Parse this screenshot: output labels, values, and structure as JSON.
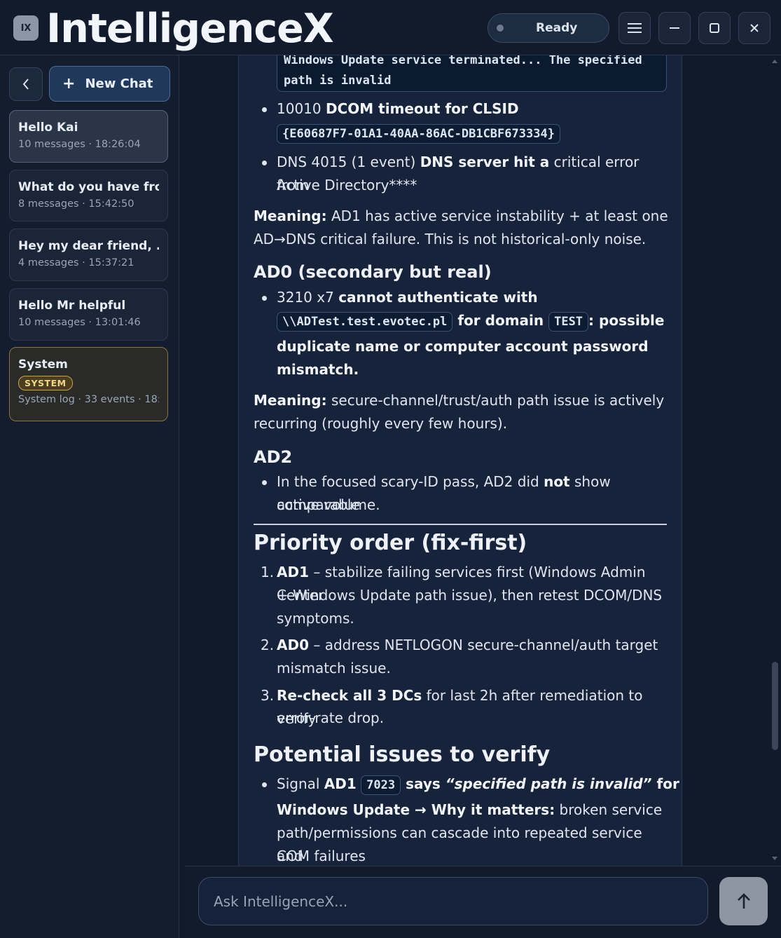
{
  "app": {
    "logo": "IX",
    "title": "IntelligenceX",
    "status": "Ready"
  },
  "sidebar": {
    "new_chat": "New Chat",
    "items": [
      {
        "title": "Hello Kai",
        "meta": "10 messages · 18:26:04"
      },
      {
        "title": "What do you have fro...",
        "meta": "8 messages · 15:42:50"
      },
      {
        "title": "Hey my dear friend, ...",
        "meta": "4 messages · 15:37:21"
      },
      {
        "title": "Hello Mr helpful",
        "meta": "10 messages · 13:01:46"
      },
      {
        "title": "System",
        "badge": "SYSTEM",
        "meta": "System log · 33 events · 18:..."
      }
    ]
  },
  "message": {
    "code1_line1": "Windows Update service terminated... The specified",
    "code1_line2": "path is invalid",
    "b1_pre": "10010 ",
    "b1_bold": "DCOM timeout for CLSID",
    "b1_code": "{E60687F7-01A1-40AA-86AC-DB1CBF673334}",
    "b2_pre": "DNS 4015 (1 event) ",
    "b2_bold": "DNS server hit a",
    "b2_rest": " critical error from",
    "b2_line2": "Active Directory****",
    "m1_label": "Meaning:",
    "m1_text": " AD1 has active service instability + at least one",
    "m1_line2": "AD→DNS critical failure. This is not historical-only noise.",
    "h_ad0": "AD0 (secondary but real)",
    "c1_pre": "3210 x7 ",
    "c1_bold": "cannot authenticate with",
    "c1_code": "\\\\ADTest.test.evotec.pl",
    "c1_mid": " for domain ",
    "c1_code2": "TEST",
    "c1_end": ": possible",
    "c1_line3": "duplicate name or computer account password",
    "c1_line4": "mismatch.",
    "m2_label": "Meaning:",
    "m2_text": " secure-channel/trust/auth path issue is actively",
    "m2_line2": "recurring (roughly every few hours).",
    "h_ad2": "AD2",
    "d1_pre": "In the focused scary-ID pass, AD2 did ",
    "d1_bold": "not",
    "d1_rest": " show comparable",
    "d1_line2": "active volume.",
    "h_priority": "Priority order (fix-first)",
    "p1_num": "1.",
    "p1_bold": "AD1",
    "p1_text": " – stabilize failing services first (Windows Admin Center",
    "p1_line2": "+ Windows Update path issue), then retest DCOM/DNS",
    "p1_line3": "symptoms.",
    "p2_num": "2.",
    "p2_bold": "AD0",
    "p2_text": " – address NETLOGON secure-channel/auth target",
    "p2_line2": "mismatch issue.",
    "p3_num": "3.",
    "p3_bold": "Re-check all 3 DCs",
    "p3_text": " for last 2h after remediation to verify",
    "p3_line2": "error-rate drop.",
    "h_potential": "Potential issues to verify",
    "e1_pre": "Signal ",
    "e1_bold": "AD1",
    "e1_code": "7023",
    "e1_says": " says ",
    "e1_quote": "“specified path is invalid”",
    "e1_for": " for",
    "e1_line2_bold": "Windows Update → Why it matters:",
    "e1_line2_rest": " broken service",
    "e1_line3": "path/permissions can cascade into repeated service and",
    "e1_line4": "COM failures"
  },
  "composer": {
    "placeholder": "Ask IntelligenceX..."
  }
}
